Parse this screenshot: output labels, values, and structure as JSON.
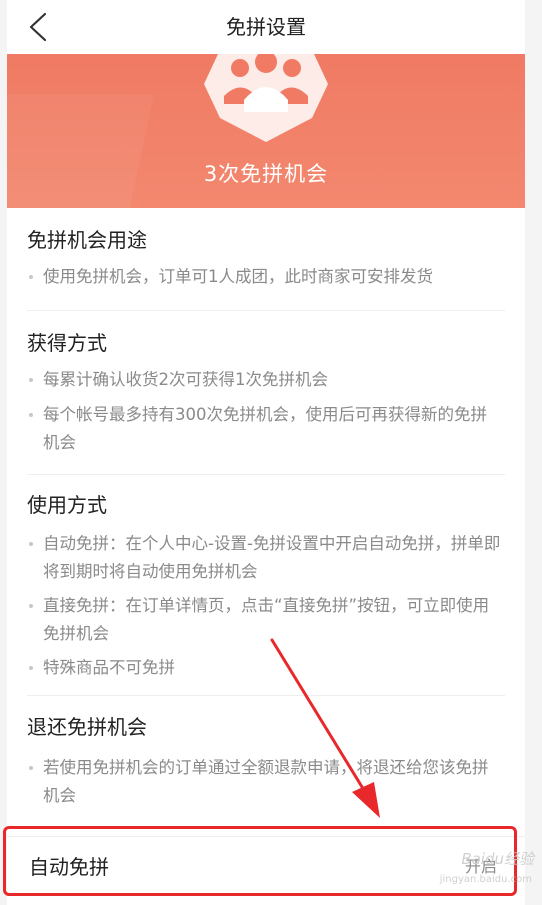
{
  "nav": {
    "title": "免拼设置"
  },
  "banner": {
    "text": "3次免拼机会"
  },
  "sections": [
    {
      "title": "免拼机会用途",
      "items": [
        "使用免拼机会，订单可1人成团，此时商家可安排发货"
      ]
    },
    {
      "title": "获得方式",
      "items": [
        "每累计确认收货2次可获得1次免拼机会",
        "每个帐号最多持有300次免拼机会，使用后可再获得新的免拼机会"
      ]
    },
    {
      "title": "使用方式",
      "items": [
        "自动免拼：在个人中心-设置-免拼设置中开启自动免拼，拼单即将到期时将自动使用免拼机会",
        "直接免拼：在订单详情页，点击“直接免拼”按钮，可立即使用免拼机会",
        "特殊商品不可免拼"
      ]
    },
    {
      "title": "退还免拼机会",
      "items": [
        "若使用免拼机会的订单通过全额退款申请，将退还给您该免拼机会"
      ]
    }
  ],
  "auto": {
    "label": "自动免拼",
    "value": "开启"
  },
  "watermark": {
    "text": "Baidu经验",
    "sub": "jingyan.baidu.com"
  },
  "colors": {
    "banner": "#f07a63",
    "highlight": "#e8282a"
  }
}
